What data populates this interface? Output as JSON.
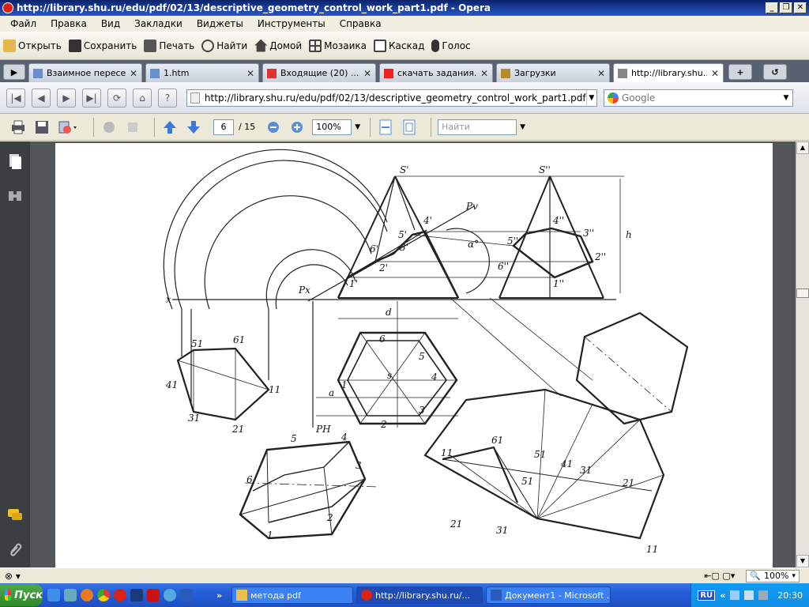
{
  "window": {
    "title": "http://library.shu.ru/edu/pdf/02/13/descriptive_geometry_control_work_part1.pdf - Opera"
  },
  "menu": [
    "Файл",
    "Правка",
    "Вид",
    "Закладки",
    "Виджеты",
    "Инструменты",
    "Справка"
  ],
  "toolbar": {
    "open": "Открыть",
    "save": "Сохранить",
    "print": "Печать",
    "find": "Найти",
    "home": "Домой",
    "mosaic": "Мозаика",
    "cascade": "Каскад",
    "voice": "Голос"
  },
  "tabs": [
    {
      "label": "Взаимное пересе...",
      "icon_color": "#6a8fcf"
    },
    {
      "label": "1.htm",
      "icon_color": "#6a8fcf"
    },
    {
      "label": "Входящие (20) ...",
      "icon_color": "#d33"
    },
    {
      "label": "скачать задания...",
      "icon_color": "#e22"
    },
    {
      "label": "Загрузки",
      "icon_color": "#b58a2a"
    },
    {
      "label": "http://library.shu...",
      "icon_color": "#888"
    }
  ],
  "address": {
    "url": "http://library.shu.ru/edu/pdf/02/13/descriptive_geometry_control_work_part1.pdf",
    "search_placeholder": "Google"
  },
  "pdf": {
    "page": "6",
    "total": "/ 15",
    "zoom": "100%",
    "find_placeholder": "Найти"
  },
  "drawing": {
    "labels": {
      "S1": "S'",
      "S2": "S''",
      "Pv": "Pv",
      "alpha": "α°",
      "h": "h",
      "x": "x",
      "Px": "Px",
      "d": "d",
      "t4p": "4'",
      "t5p": "5'",
      "t3p": "3'",
      "t6p": "6'",
      "t2p": "2'",
      "t1p": "1'",
      "t4pp": "4''",
      "t5pp": "5''",
      "t3pp": "3''",
      "t2pp": "2''",
      "t6pp": "6''",
      "t1pp": "1''",
      "b51": "51",
      "b61": "61",
      "b41": "41",
      "b11": "11",
      "b31": "31",
      "b21": "21",
      "c6": "6",
      "c5": "5",
      "c4": "4",
      "c3": "3",
      "c2": "2",
      "c1": "1",
      "cs": "s",
      "ca": "a",
      "PH": "PH",
      "i5": "5",
      "i4": "4",
      "i3": "3",
      "i6": "6",
      "i2": "2",
      "i1": "1",
      "u11": "11",
      "u61": "61",
      "u51": "51",
      "u41": "41",
      "u31": "31",
      "u21": "21",
      "u5b": "51",
      "u2b": "21",
      "u3b": "31",
      "u1b": "11"
    }
  },
  "status": {
    "zoom": "100%"
  },
  "taskbar": {
    "start": "Пуск",
    "tasks": [
      {
        "label": "метода pdf",
        "icon_color": "#e8c04a"
      },
      {
        "label": "http://library.shu.ru/...",
        "icon_color": "#d21"
      },
      {
        "label": "Документ1 - Microsoft ...",
        "icon_color": "#2b5bb8"
      }
    ],
    "lang": "RU",
    "clock": "20:30"
  }
}
